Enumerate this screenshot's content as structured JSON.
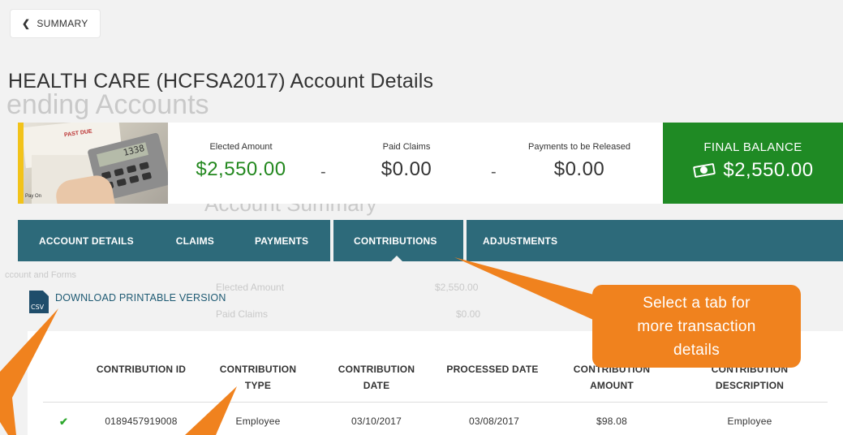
{
  "back_button": {
    "label": "SUMMARY"
  },
  "page_title": "HEALTH CARE (HCFSA2017) Account Details",
  "summary": {
    "elected": {
      "label": "Elected Amount",
      "value": "$2,550.00"
    },
    "paid": {
      "label": "Paid Claims",
      "value": "$0.00"
    },
    "released": {
      "label": "Payments to be Released",
      "value": "$0.00"
    },
    "final": {
      "label": "FINAL BALANCE",
      "value": "$2,550.00"
    },
    "operator": "-",
    "photo": {
      "display": "1338",
      "past_due": "PAST DUE",
      "pay_on": "Pay On"
    }
  },
  "tabs": [
    {
      "label": "ACCOUNT DETAILS"
    },
    {
      "label": "CLAIMS"
    },
    {
      "label": "PAYMENTS"
    },
    {
      "label": "CONTRIBUTIONS",
      "active": true
    },
    {
      "label": "ADJUSTMENTS"
    }
  ],
  "download": {
    "icon_label": "CSV",
    "label": "DOWNLOAD PRINTABLE VERSION"
  },
  "table": {
    "headers": {
      "id": "CONTRIBUTION ID",
      "type_1": "CONTRIBUTION",
      "type_2": "TYPE",
      "date_1": "CONTRIBUTION",
      "date_2": "DATE",
      "processed": "PROCESSED DATE",
      "amount_1": "CONTRIBUTION",
      "amount_2": "AMOUNT",
      "desc_1": "CONTRIBUTION",
      "desc_2": "DESCRIPTION"
    },
    "rows": [
      {
        "status_icon": "check-icon",
        "id": "0189457919008",
        "type": "Employee",
        "date": "03/10/2017",
        "processed": "03/08/2017",
        "amount": "$98.08",
        "description": "Employee"
      }
    ]
  },
  "callout": {
    "line1": "Select a tab for",
    "line2": "more transaction",
    "line3": "details"
  },
  "background_ghost": {
    "heading": "ending Accounts",
    "section": "Account Summary",
    "left_link": "ccount and Forms",
    "rows": [
      {
        "label": "Elected Amount",
        "value": "$2,550.00"
      },
      {
        "label": "Paid Claims",
        "value": "$0.00"
      }
    ]
  },
  "colors": {
    "tab_bar": "#2d6a7a",
    "final_balance": "#1f8a24",
    "elected_value": "#23881f",
    "callout": "#f0821e",
    "stripe": "#f2c31a"
  }
}
